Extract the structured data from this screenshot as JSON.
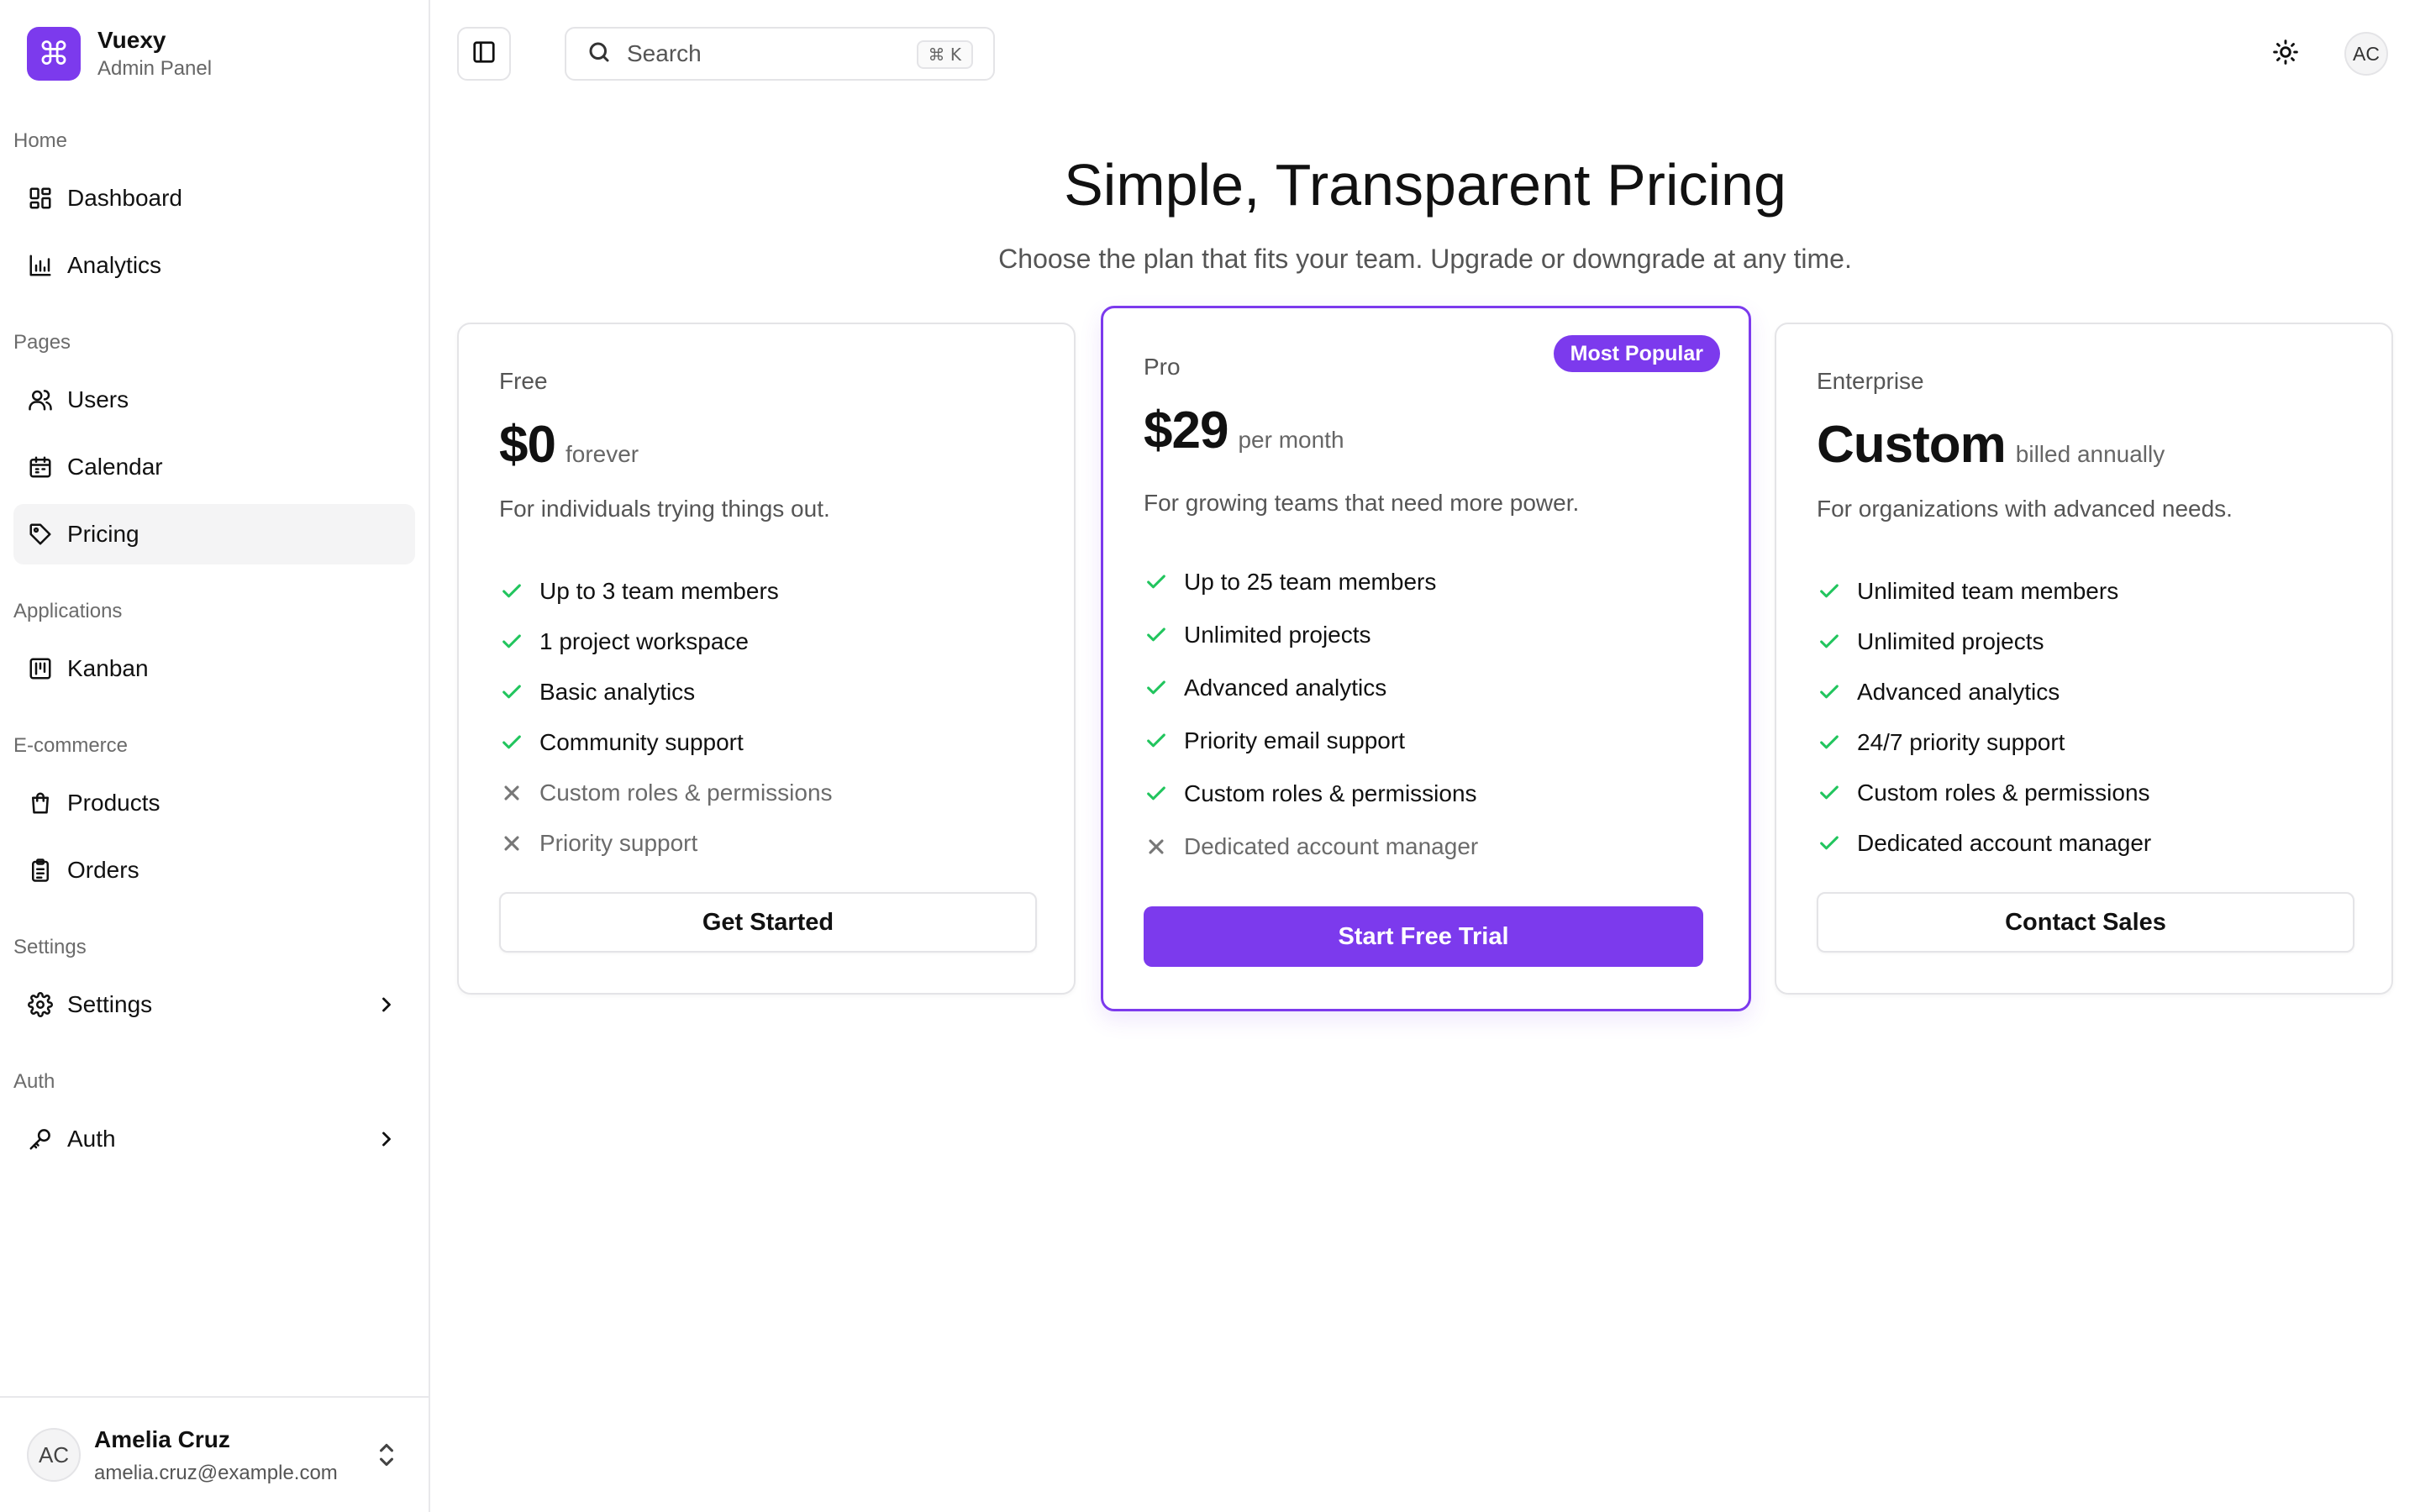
{
  "brand": {
    "logo_glyph": "⌘",
    "name": "Vuexy",
    "subtitle": "Admin Panel",
    "accent_color": "#7c3aed"
  },
  "sidebar": {
    "groups": [
      {
        "label": "Home",
        "items": [
          {
            "label": "Dashboard",
            "icon": "dashboard-icon"
          },
          {
            "label": "Analytics",
            "icon": "bar-chart-icon"
          }
        ]
      },
      {
        "label": "Pages",
        "items": [
          {
            "label": "Users",
            "icon": "users-icon"
          },
          {
            "label": "Calendar",
            "icon": "calendar-icon"
          },
          {
            "label": "Pricing",
            "icon": "tag-icon",
            "active": true
          }
        ]
      },
      {
        "label": "Applications",
        "items": [
          {
            "label": "Kanban",
            "icon": "kanban-icon"
          }
        ]
      },
      {
        "label": "E-commerce",
        "items": [
          {
            "label": "Products",
            "icon": "shopping-bag-icon"
          },
          {
            "label": "Orders",
            "icon": "clipboard-icon"
          }
        ]
      },
      {
        "label": "Settings",
        "items": [
          {
            "label": "Settings",
            "icon": "gear-icon",
            "has_submenu": true
          }
        ]
      },
      {
        "label": "Auth",
        "items": [
          {
            "label": "Auth",
            "icon": "key-icon",
            "has_submenu": true
          }
        ]
      }
    ]
  },
  "user": {
    "initials": "AC",
    "name": "Amelia Cruz",
    "email": "amelia.cruz@example.com"
  },
  "header": {
    "search_placeholder": "Search",
    "search_shortcut": "⌘ K",
    "avatar_initials": "AC"
  },
  "pricing": {
    "title": "Simple, Transparent Pricing",
    "subtitle": "Choose the plan that fits your team. Upgrade or downgrade at any time.",
    "plans": [
      {
        "name": "Free",
        "price": "$0",
        "period": "forever",
        "description": "For individuals trying things out.",
        "features": [
          {
            "text": "Up to 3 team members",
            "included": true
          },
          {
            "text": "1 project workspace",
            "included": true
          },
          {
            "text": "Basic analytics",
            "included": true
          },
          {
            "text": "Community support",
            "included": true
          },
          {
            "text": "Custom roles & permissions",
            "included": false
          },
          {
            "text": "Priority support",
            "included": false
          }
        ],
        "cta": "Get Started"
      },
      {
        "name": "Pro",
        "price": "$29",
        "period": "per month",
        "badge": "Most Popular",
        "description": "For growing teams that need more power.",
        "features": [
          {
            "text": "Up to 25 team members",
            "included": true
          },
          {
            "text": "Unlimited projects",
            "included": true
          },
          {
            "text": "Advanced analytics",
            "included": true
          },
          {
            "text": "Priority email support",
            "included": true
          },
          {
            "text": "Custom roles & permissions",
            "included": true
          },
          {
            "text": "Dedicated account manager",
            "included": false
          }
        ],
        "cta": "Start Free Trial"
      },
      {
        "name": "Enterprise",
        "price": "Custom",
        "period": "billed annually",
        "description": "For organizations with advanced needs.",
        "features": [
          {
            "text": "Unlimited team members",
            "included": true
          },
          {
            "text": "Unlimited projects",
            "included": true
          },
          {
            "text": "Advanced analytics",
            "included": true
          },
          {
            "text": "24/7 priority support",
            "included": true
          },
          {
            "text": "Custom roles & permissions",
            "included": true
          },
          {
            "text": "Dedicated account manager",
            "included": true
          }
        ],
        "cta": "Contact Sales"
      }
    ]
  },
  "colors": {
    "accent": "#7c3aed",
    "check": "#22c55e",
    "border": "#e4e4e7"
  }
}
